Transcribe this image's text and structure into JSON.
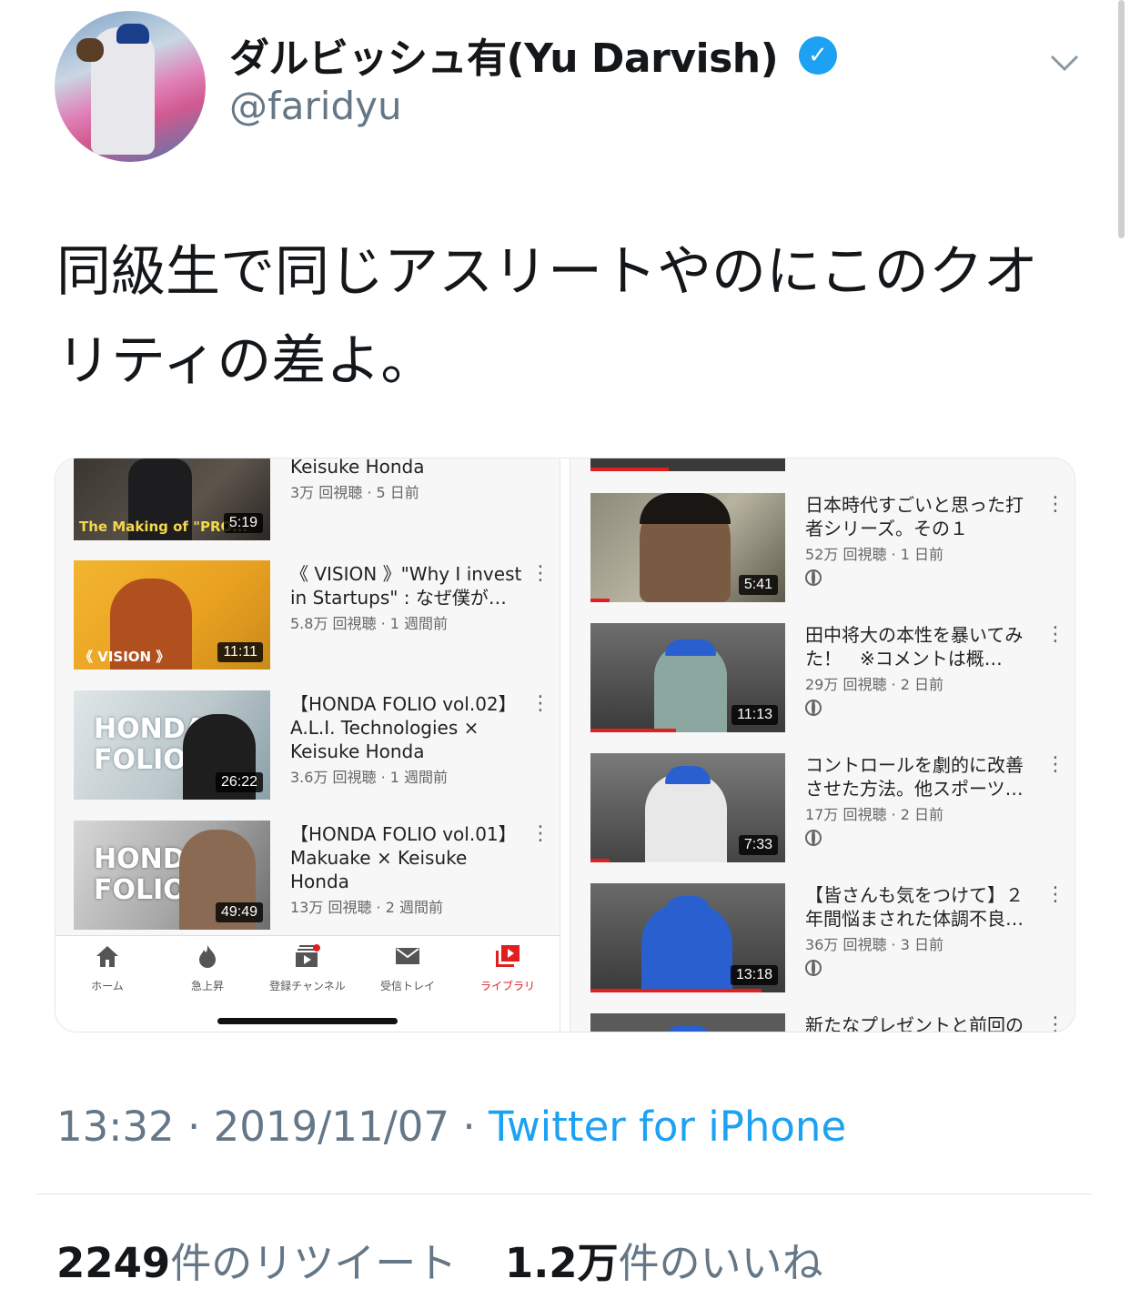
{
  "author": {
    "display_name": "ダルビッシュ有(Yu Darvish)",
    "handle": "@faridyu",
    "verified_icon": "verified-badge-icon"
  },
  "tweet": {
    "text": "同級生で同じアスリートやのにこのクオリティの差よ。",
    "time": "13:32",
    "date": "2019/11/07",
    "source": "Twitter for iPhone",
    "retweets": "2249",
    "retweets_label": "件のリツイート",
    "likes": "1.2万",
    "likes_label": "件のいいね"
  },
  "left_screenshot": {
    "videos": [
      {
        "title": "Keisuke Honda",
        "meta": "3万 回視聴 · 5 日前",
        "duration": "5:19",
        "overlay": "The Making of \"PRO..."
      },
      {
        "title": "《 VISION 》\"Why I invest in Startups\" : なぜ僕が…",
        "meta": "5.8万 回視聴 · 1 週間前",
        "duration": "11:11",
        "overlay": "《 VISION 》"
      },
      {
        "title": "【HONDA FOLIO vol.02】A.L.I. Technologies × Keisuke Honda",
        "meta": "3.6万 回視聴 · 1 週間前",
        "duration": "26:22",
        "overlay": "HONDA FOLIO"
      },
      {
        "title": "【HONDA FOLIO vol.01】Makuake × Keisuke Honda",
        "meta": "13万 回視聴 · 2 週間前",
        "duration": "49:49",
        "overlay": "HONDA FOLIO"
      }
    ],
    "tabs": [
      {
        "label": "ホーム",
        "icon": "home-icon"
      },
      {
        "label": "急上昇",
        "icon": "flame-icon"
      },
      {
        "label": "登録チャンネル",
        "icon": "subscriptions-icon"
      },
      {
        "label": "受信トレイ",
        "icon": "inbox-icon"
      },
      {
        "label": "ライブラリ",
        "icon": "library-icon"
      }
    ],
    "active_tab_color": "#e02020"
  },
  "right_screenshot": {
    "videos": [
      {
        "title": "日本時代すごいと思った打者シリーズ。その１",
        "meta": "52万 回視聴 · 1 日前",
        "duration": "5:41",
        "progress": 0.1
      },
      {
        "title": "田中将大の本性を暴いてみた！　※コメントは概…",
        "meta": "29万 回視聴 · 2 日前",
        "duration": "11:13",
        "progress": 0.44
      },
      {
        "title": "コントロールを劇的に改善させた方法。他スポーツ…",
        "meta": "17万 回視聴 · 2 日前",
        "duration": "7:33",
        "progress": 0.1
      },
      {
        "title": "【皆さんも気をつけて】２年間悩まされた体調不良…",
        "meta": "36万 回視聴 · 3 日前",
        "duration": "13:18",
        "progress": 0.88
      },
      {
        "title": "新たなプレゼントと前回の",
        "meta": "",
        "duration": "",
        "progress": 0
      }
    ]
  }
}
